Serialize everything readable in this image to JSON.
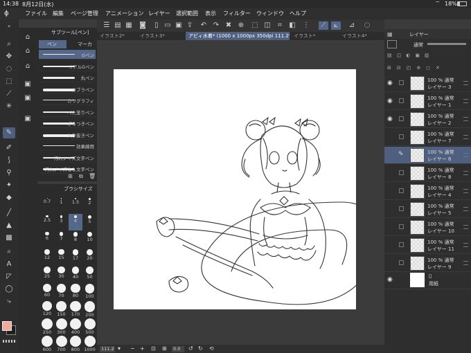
{
  "status": {
    "time": "14:38",
    "date": "8月12日(水)",
    "battery": "18%"
  },
  "menu": [
    "ファイル",
    "編集",
    "ページ管理",
    "アニメーション",
    "レイヤー",
    "選択範囲",
    "表示",
    "フィルター",
    "ウィンドウ",
    "ヘルプ"
  ],
  "tabs": [
    {
      "label": "イラスト2*",
      "active": false
    },
    {
      "label": "イラスト3*",
      "active": false
    },
    {
      "label": "アビィ水着* (1000 x 1000px 350dpi 111.2%)",
      "active": true
    },
    {
      "label": "イラスト*",
      "active": false
    },
    {
      "label": "イラスト4*",
      "active": false
    }
  ],
  "subtool": {
    "header": "サブツール[ペン]",
    "tabs": [
      "ペン",
      "マーカー"
    ],
    "brushes": [
      "Gペン",
      "リアルGペン",
      "丸ペン",
      "カブラペン",
      "カリグラフィ",
      "べた塗りペン",
      "ざらつきペン",
      "入り抜きペン",
      "効果線用",
      "汚れノイズ文字ペン",
      "汚れノイズなし文字ペン"
    ],
    "selected_index": 0
  },
  "brushsize": {
    "header": "ブラシサイズ",
    "sizes": [
      "0.7",
      "1",
      "1.5",
      "2",
      "2.5",
      "3",
      "4",
      "5",
      "6",
      "7",
      "8",
      "10",
      "12",
      "15",
      "17",
      "20",
      "25",
      "30",
      "40",
      "50",
      "60",
      "70",
      "80",
      "100",
      "120",
      "150",
      "170",
      "200",
      "250",
      "300",
      "400",
      "500",
      "600",
      "700",
      "800",
      "1000"
    ],
    "selected": "4"
  },
  "layers": {
    "header": "レイヤー",
    "blend_mode": "通常",
    "items": [
      {
        "opacity": "100 % 通常",
        "name": "レイヤー 3",
        "visible": true,
        "selected": false
      },
      {
        "opacity": "100 % 通常",
        "name": "レイヤー 1",
        "visible": true,
        "selected": false
      },
      {
        "opacity": "100 % 通常",
        "name": "レイヤー 2",
        "visible": true,
        "selected": false
      },
      {
        "opacity": "100 % 通常",
        "name": "レイヤー 7",
        "visible": false,
        "selected": false
      },
      {
        "opacity": "100 % 通常",
        "name": "レイヤー 6",
        "visible": false,
        "selected": true
      },
      {
        "opacity": "100 % 通常",
        "name": "レイヤー 8",
        "visible": false,
        "selected": false
      },
      {
        "opacity": "100 % 通常",
        "name": "レイヤー 4",
        "visible": false,
        "selected": false
      },
      {
        "opacity": "100 % 通常",
        "name": "レイヤー 5",
        "visible": false,
        "selected": false
      },
      {
        "opacity": "100 % 通常",
        "name": "レイヤー 10",
        "visible": false,
        "selected": false
      },
      {
        "opacity": "100 % 通常",
        "name": "レイヤー 11",
        "visible": false,
        "selected": false
      },
      {
        "opacity": "100 % 通常",
        "name": "レイヤー 9",
        "visible": false,
        "selected": false
      }
    ],
    "paper": "用紙"
  },
  "bottombar": {
    "zoom": "111.2",
    "angle": "0.0"
  },
  "colors": {
    "main": "#f4a89a",
    "sub": "#1e1e1e",
    "accent": "#56688a"
  }
}
